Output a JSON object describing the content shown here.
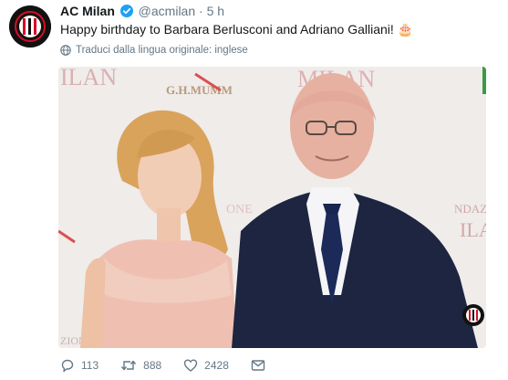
{
  "account": {
    "name": "AC Milan",
    "handle": "@acmilan",
    "separator": "·",
    "time": "5 h"
  },
  "tweet": {
    "text": "Happy birthday to Barbara Berlusconi and Adriano Galliani! 🎂",
    "translate_label": "Traduci dalla lingua originale: inglese"
  },
  "photo": {
    "backdrop_text": [
      "ILAN",
      "G.H.MUMM",
      "MILAN",
      "ONE",
      "NDAZ",
      "ILAN",
      "ZION"
    ]
  },
  "actions": {
    "replies": "113",
    "retweets": "888",
    "likes": "2428"
  },
  "colors": {
    "verified": "#1da1f2",
    "muted_text": "#657786",
    "milan_red": "#d40f24",
    "logo_black": "#111111"
  },
  "icons": [
    "verified-badge-icon",
    "globe-icon",
    "reply-icon",
    "retweet-icon",
    "like-icon",
    "dm-icon"
  ]
}
